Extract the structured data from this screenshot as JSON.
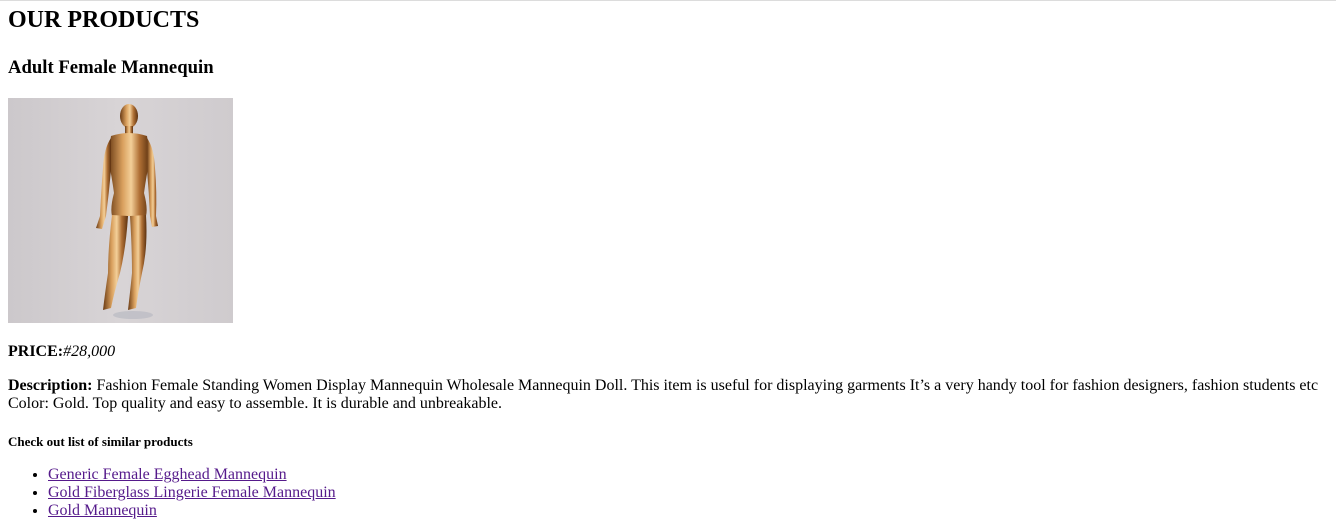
{
  "page": {
    "heading": "OUR PRODUCTS"
  },
  "product": {
    "name": "Adult Female Mannequin",
    "image_alt": "Gold mannequin",
    "price_label": "PRICE:",
    "price_value": "#28,000",
    "description_label": "Description:",
    "description_text": " Fashion Female Standing Women Display Mannequin Wholesale Mannequin Doll. This item is useful for displaying garments It’s a very handy tool for fashion designers, fashion students etc Color: Gold. Top quality and easy to assemble. It is durable and unbreakable."
  },
  "similar": {
    "heading": "Check out list of similar products",
    "items": [
      {
        "label": "Generic Female Egghead Mannequin"
      },
      {
        "label": "Gold Fiberglass Lingerie Female Mannequin"
      },
      {
        "label": "Gold Mannequin"
      }
    ]
  }
}
